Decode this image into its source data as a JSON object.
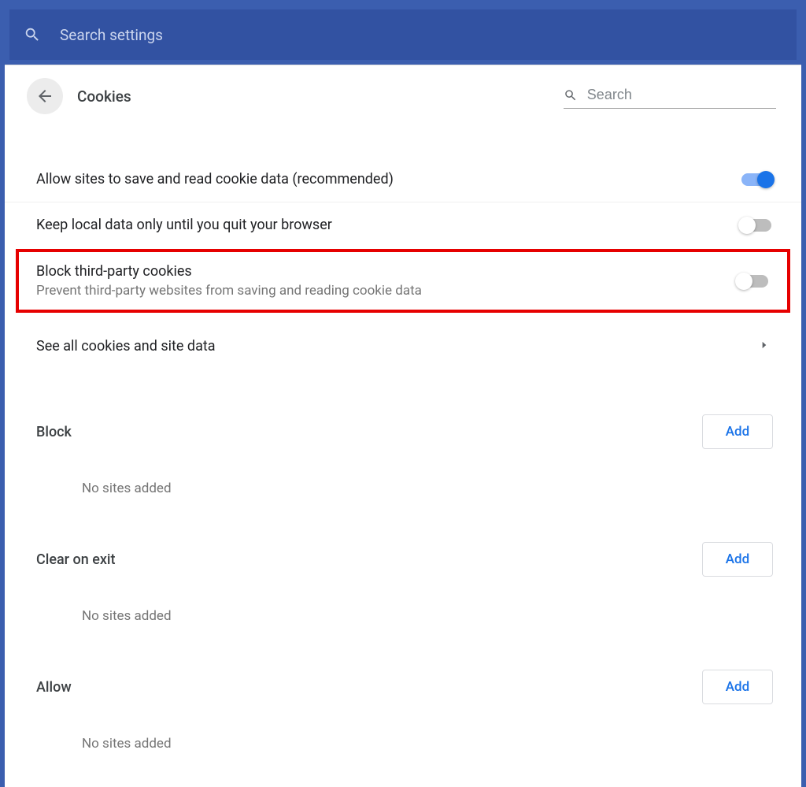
{
  "topbar": {
    "search_placeholder": "Search settings"
  },
  "header": {
    "title": "Cookies",
    "search_placeholder": "Search"
  },
  "options": {
    "allow_cookies": {
      "title": "Allow sites to save and read cookie data (recommended)",
      "on": true
    },
    "keep_local": {
      "title": "Keep local data only until you quit your browser",
      "on": false
    },
    "block_third_party": {
      "title": "Block third-party cookies",
      "subtitle": "Prevent third-party websites from saving and reading cookie data",
      "on": false
    },
    "see_all": {
      "title": "See all cookies and site data"
    }
  },
  "sections": {
    "block": {
      "title": "Block",
      "add_label": "Add",
      "empty": "No sites added"
    },
    "clear_on_exit": {
      "title": "Clear on exit",
      "add_label": "Add",
      "empty": "No sites added"
    },
    "allow": {
      "title": "Allow",
      "add_label": "Add",
      "empty": "No sites added"
    }
  }
}
